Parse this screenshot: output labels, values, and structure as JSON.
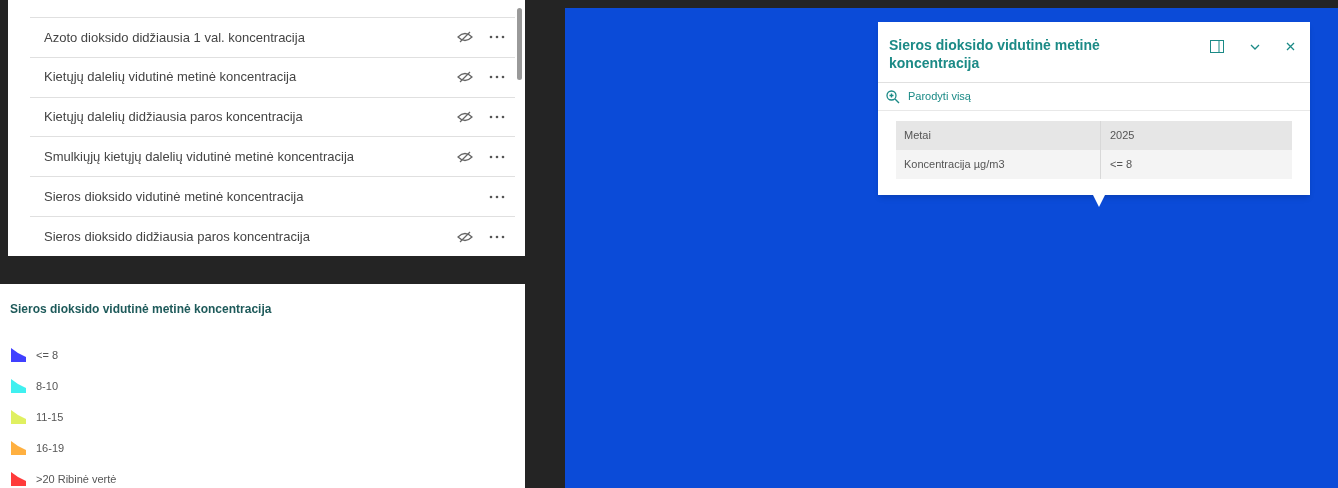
{
  "layers": [
    {
      "name": "Azoto dioksido didžiausia 1 val. koncentracija",
      "hidden": true
    },
    {
      "name": "Kietųjų dalelių vidutinė metinė koncentracija",
      "hidden": true
    },
    {
      "name": "Kietųjų dalelių didžiausia paros koncentracija",
      "hidden": true
    },
    {
      "name": "Smulkiųjų kietųjų dalelių vidutinė metinė koncentracija",
      "hidden": true
    },
    {
      "name": "Sieros dioksido vidutinė metinė koncentracija",
      "hidden": false
    },
    {
      "name": "Sieros dioksido didžiausia paros koncentracija",
      "hidden": true
    }
  ],
  "legend": {
    "title": "Sieros dioksido vidutinė metinė koncentracija",
    "items": [
      {
        "label": "<= 8",
        "color": "#4040ff"
      },
      {
        "label": "8-10",
        "color": "#40f0f0"
      },
      {
        "label": "11-15",
        "color": "#e0f060"
      },
      {
        "label": "16-19",
        "color": "#ffb040"
      },
      {
        "label": ">20 Ribinė vertė",
        "color": "#ff3a3a"
      }
    ]
  },
  "popup": {
    "title": "Sieros dioksido vidutinė metinė koncentracija",
    "zoom_action": "Parodyti visą",
    "rows": [
      {
        "field": "Metai",
        "value": "2025"
      },
      {
        "field": "Koncentracija µg/m3",
        "value": "<= 8"
      }
    ]
  }
}
